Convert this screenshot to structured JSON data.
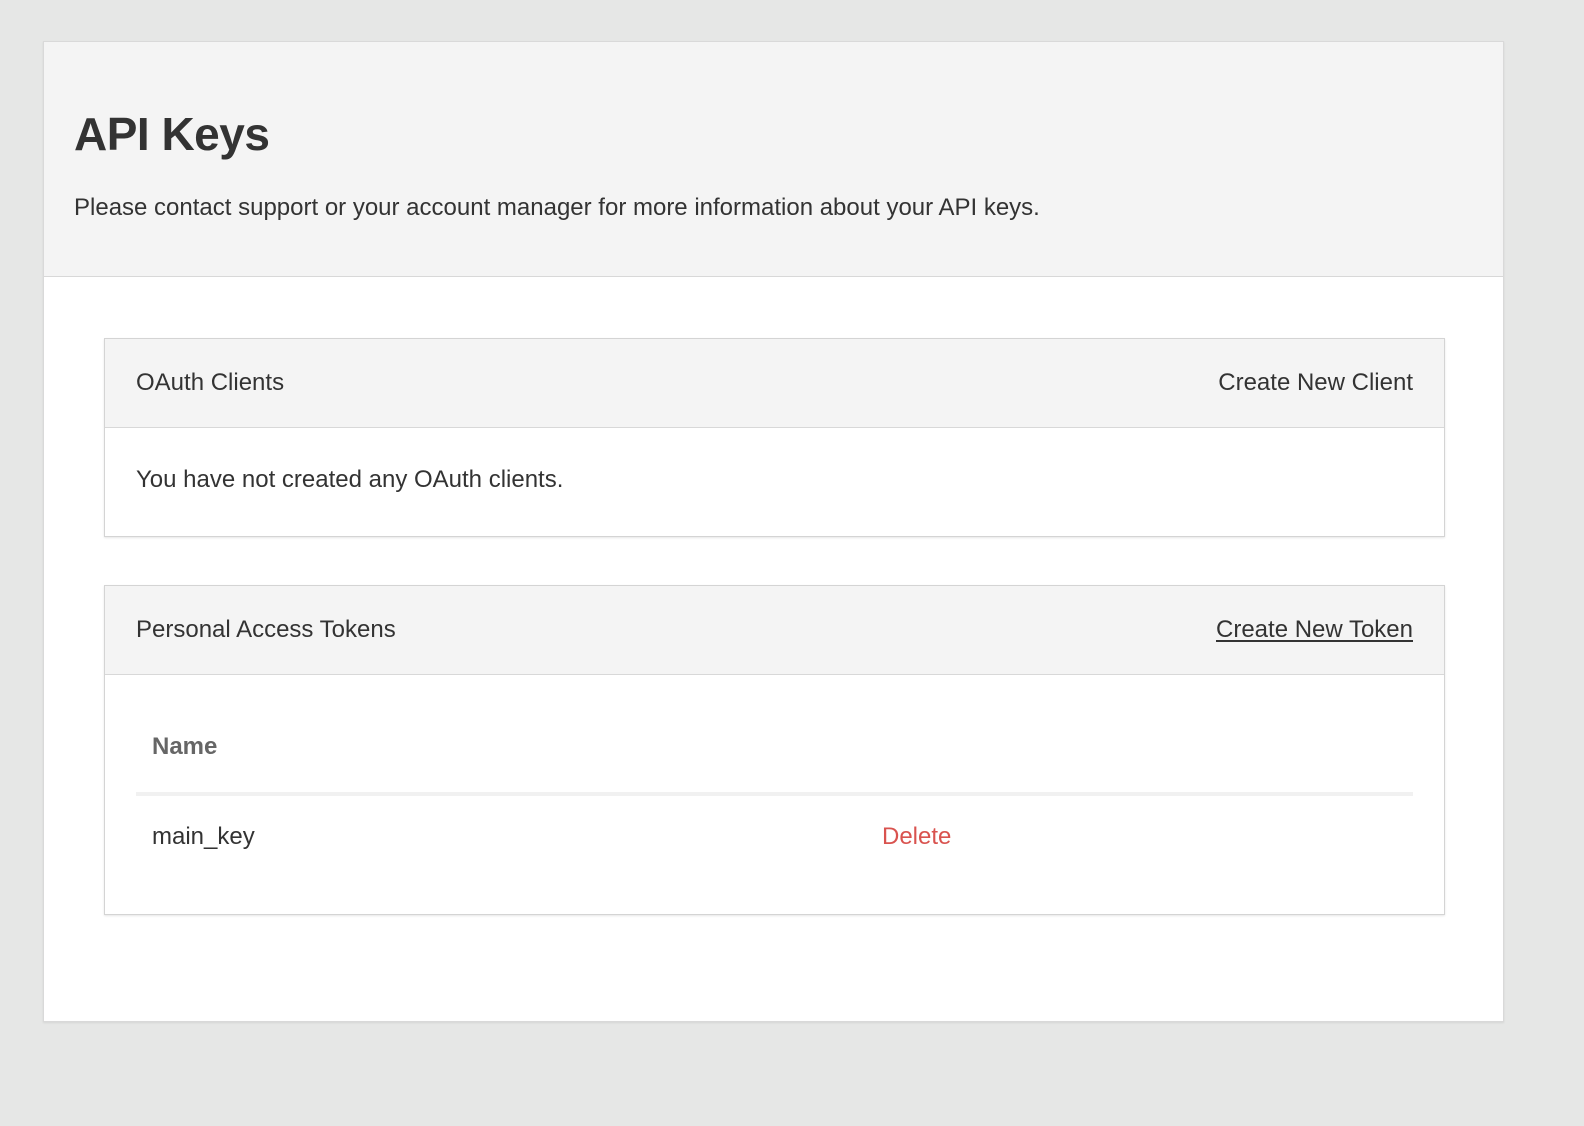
{
  "page": {
    "title": "API Keys",
    "subtitle": "Please contact support or your account manager for more information about your API keys."
  },
  "oauth_clients": {
    "title": "OAuth Clients",
    "action_label": "Create New Client",
    "empty_message": "You have not created any OAuth clients."
  },
  "personal_access_tokens": {
    "title": "Personal Access Tokens",
    "action_label": "Create New Token",
    "columns": [
      "Name"
    ],
    "rows": [
      {
        "name": "main_key",
        "delete_label": "Delete"
      }
    ]
  },
  "colors": {
    "background": "#e6e7e6",
    "header_bg": "#f4f4f4",
    "text": "#333333",
    "muted_header": "#666666",
    "danger": "#d9534f"
  }
}
